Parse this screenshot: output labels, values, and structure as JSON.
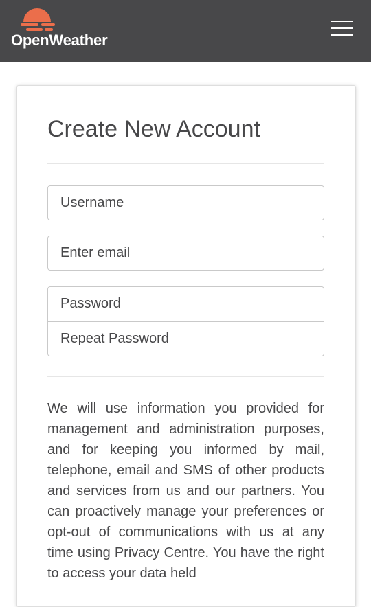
{
  "header": {
    "brand": "OpenWeather",
    "logo_icon": "sun-cloud-logo",
    "menu_icon": "hamburger-menu-icon",
    "accent_color": "#eb6e4b",
    "background_color": "#48484a"
  },
  "form": {
    "title": "Create New Account",
    "username_placeholder": "Username",
    "email_placeholder": "Enter email",
    "password_placeholder": "Password",
    "repeat_password_placeholder": "Repeat Password"
  },
  "notice": {
    "text": "We will use information you provided for management and administration purposes, and for keeping you informed by mail, telephone, email and SMS of other products and services from us and our partners. You can proactively manage your preferences or opt-out of communications with us at any time using Privacy Centre. You have the right to access your data held"
  }
}
